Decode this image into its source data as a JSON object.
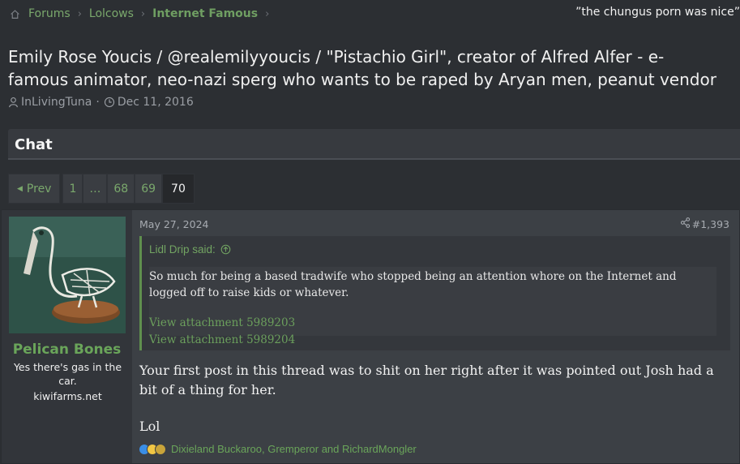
{
  "breadcrumb": {
    "home_icon": "home-icon",
    "items": [
      {
        "label": "Forums"
      },
      {
        "label": "Lolcows"
      },
      {
        "label": "Internet Famous"
      }
    ]
  },
  "top_quote": "”the chungus porn was nice”",
  "thread": {
    "title": "Emily Rose Youcis / @realemilyyoucis / \"Pistachio Girl\", creator of Alfred Alfer - e-famous animator, neo-nazi sperg who wants to be raped by Aryan men, peanut vendor",
    "author": "InLivingTuna",
    "date": "Dec 11, 2016"
  },
  "section": {
    "label": "Chat"
  },
  "pagination": {
    "prev_label": "Prev",
    "pages": [
      "1",
      "…",
      "68",
      "69",
      "70"
    ],
    "current": "70"
  },
  "post": {
    "user": {
      "name": "Pelican Bones",
      "title": "Yes there's gas in the car.",
      "site": "kiwifarms.net",
      "avatar_icon": "pelican-skeleton-avatar"
    },
    "date": "May 27, 2024",
    "number": "#1,393",
    "quote": {
      "author_label": "Lidl Drip said:",
      "text": "So much for being a based tradwife who stopped being an attention whore on the Internet and logged off to raise kids or whatever.",
      "attachments": [
        "View attachment 5989203",
        "View attachment 5989204"
      ]
    },
    "body": "Your first post in this thread was to shit on her right after it was pointed out Josh had a bit of a thing for her.",
    "closing": "Lol",
    "reactions": {
      "icons": [
        "like-icon",
        "thinking-icon",
        "pineapple-icon"
      ],
      "users": "Dixieland Buckaroo, Gremperor and RichardMongler"
    }
  },
  "colors": {
    "background": "#2c2f33",
    "link_green": "#7aa86c",
    "username_green": "#6aa55a"
  }
}
